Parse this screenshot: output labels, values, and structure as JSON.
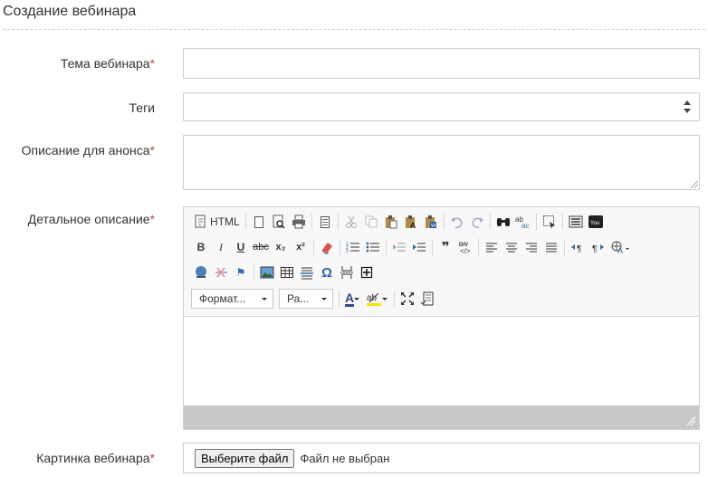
{
  "form": {
    "title": "Создание вебинара",
    "required_mark": "*",
    "fields": {
      "topic": {
        "label": "Тема вебинара",
        "value": ""
      },
      "tags": {
        "label": "Теги",
        "value": ""
      },
      "announce": {
        "label": "Описание для анонса",
        "value": ""
      },
      "details": {
        "label": "Детальное описание"
      },
      "image": {
        "label": "Картинка вебинара",
        "button": "Выберите файл",
        "status": "Файл не выбран"
      }
    }
  },
  "editor": {
    "source_label": "HTML",
    "format_combo": "Формат...",
    "size_combo": "Ра...",
    "buttons": {
      "bold": "B",
      "italic": "I",
      "underline": "U",
      "strike": "abc",
      "subscript": "x₂",
      "superscript": "x²",
      "omega": "Ω",
      "quote": "❞",
      "text_color": "A",
      "anchor": "⚑"
    },
    "colors": {
      "accent": "#2e6aa8",
      "status_bar": "#c8c8c8",
      "required": "#b94a48"
    }
  }
}
